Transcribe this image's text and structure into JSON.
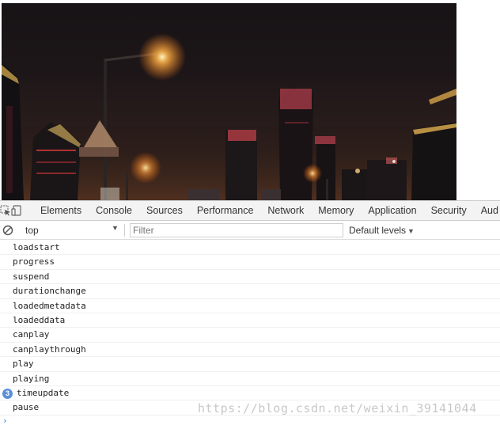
{
  "devtools": {
    "tabs": [
      "Elements",
      "Console",
      "Sources",
      "Performance",
      "Network",
      "Memory",
      "Application",
      "Security",
      "Aud"
    ]
  },
  "console": {
    "context": "top",
    "filter_placeholder": "Filter",
    "levels": "Default levels",
    "logs": [
      {
        "text": "loadstart"
      },
      {
        "text": "progress"
      },
      {
        "text": "suspend"
      },
      {
        "text": "durationchange"
      },
      {
        "text": "loadedmetadata"
      },
      {
        "text": "loadeddata"
      },
      {
        "text": "canplay"
      },
      {
        "text": "canplaythrough"
      },
      {
        "text": "play"
      },
      {
        "text": "playing"
      },
      {
        "text": "timeupdate",
        "repeat": "3"
      },
      {
        "text": "pause"
      }
    ],
    "prompt": "›"
  },
  "watermark": "https://blog.csdn.net/weixin_39141044",
  "icons": {
    "inspect": "inspect-element-icon",
    "device": "device-toolbar-icon",
    "clear": "clear-console-icon"
  },
  "colors": {
    "repeat_badge": "#5a8fd8",
    "prompt": "#3a7be0"
  }
}
